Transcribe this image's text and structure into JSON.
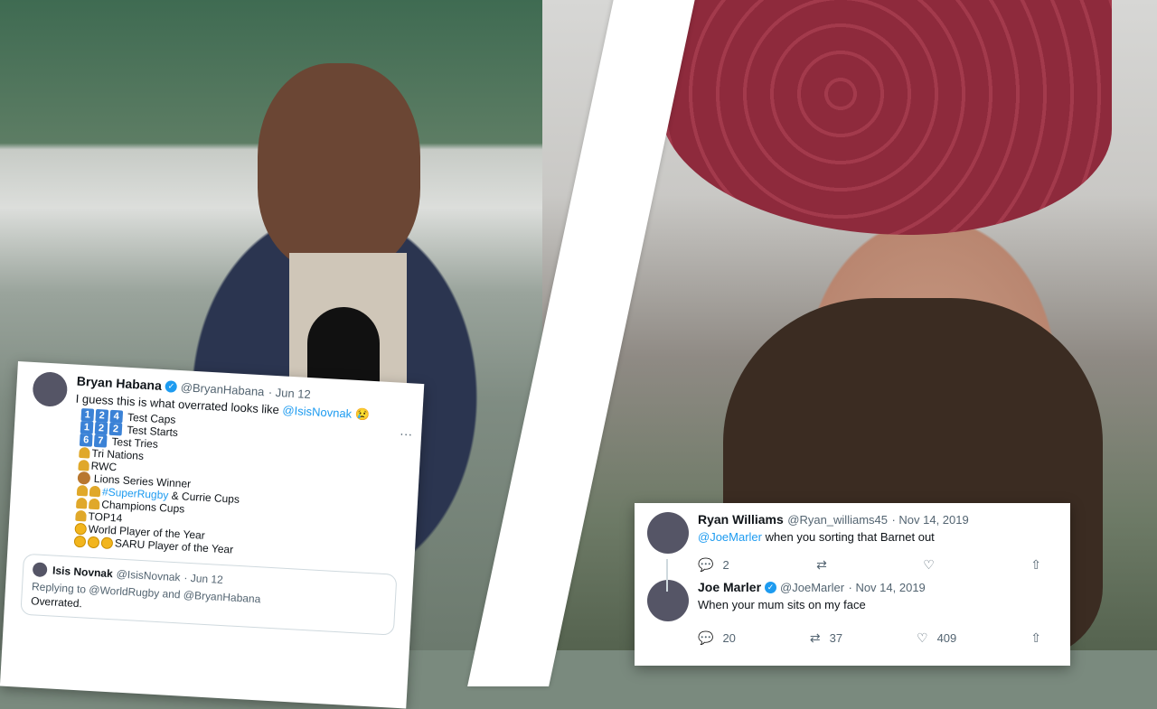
{
  "left_tweet": {
    "name": "Bryan Habana",
    "handle": "@BryanHabana",
    "date": "· Jun 12",
    "text_prefix": "I guess this is what overrated looks like",
    "mention": "@IsisNovnak",
    "emoji": "😢",
    "more": "···",
    "stats": [
      {
        "digits": [
          "1",
          "2",
          "4"
        ],
        "label": "Test Caps"
      },
      {
        "digits": [
          "1",
          "2",
          "2"
        ],
        "label": "Test Starts"
      },
      {
        "digits": [
          "6",
          "7"
        ],
        "label": "Test Tries"
      }
    ],
    "achievements": [
      {
        "icon": "trophy",
        "label": "Tri Nations"
      },
      {
        "icon": "trophy",
        "label": "RWC"
      },
      {
        "icon": "lion",
        "label": "Lions Series Winner"
      }
    ],
    "cups_hashtag": "#SuperRugby",
    "cups_rest": "& Currie Cups",
    "champions": "Champions Cups",
    "top14": "TOP14",
    "world_player": "World Player of the Year",
    "saru_player": "SARU Player of the Year",
    "quote": {
      "name": "Isis Novnak",
      "handle": "@IsisNovnak",
      "date": "· Jun 12",
      "replying": "Replying to @WorldRugby and @BryanHabana",
      "text": "Overrated."
    }
  },
  "right_tweets": [
    {
      "name": "Ryan Williams",
      "handle": "@Ryan_williams45",
      "date": "· Nov 14, 2019",
      "mention": "@JoeMarler",
      "text": "when you sorting that Barnet out",
      "replies": "2"
    },
    {
      "name": "Joe Marler",
      "handle": "@JoeMarler",
      "date": "· Nov 14, 2019",
      "text": "When your mum sits on my face",
      "replies": "20",
      "retweets": "37",
      "likes": "409"
    }
  ]
}
